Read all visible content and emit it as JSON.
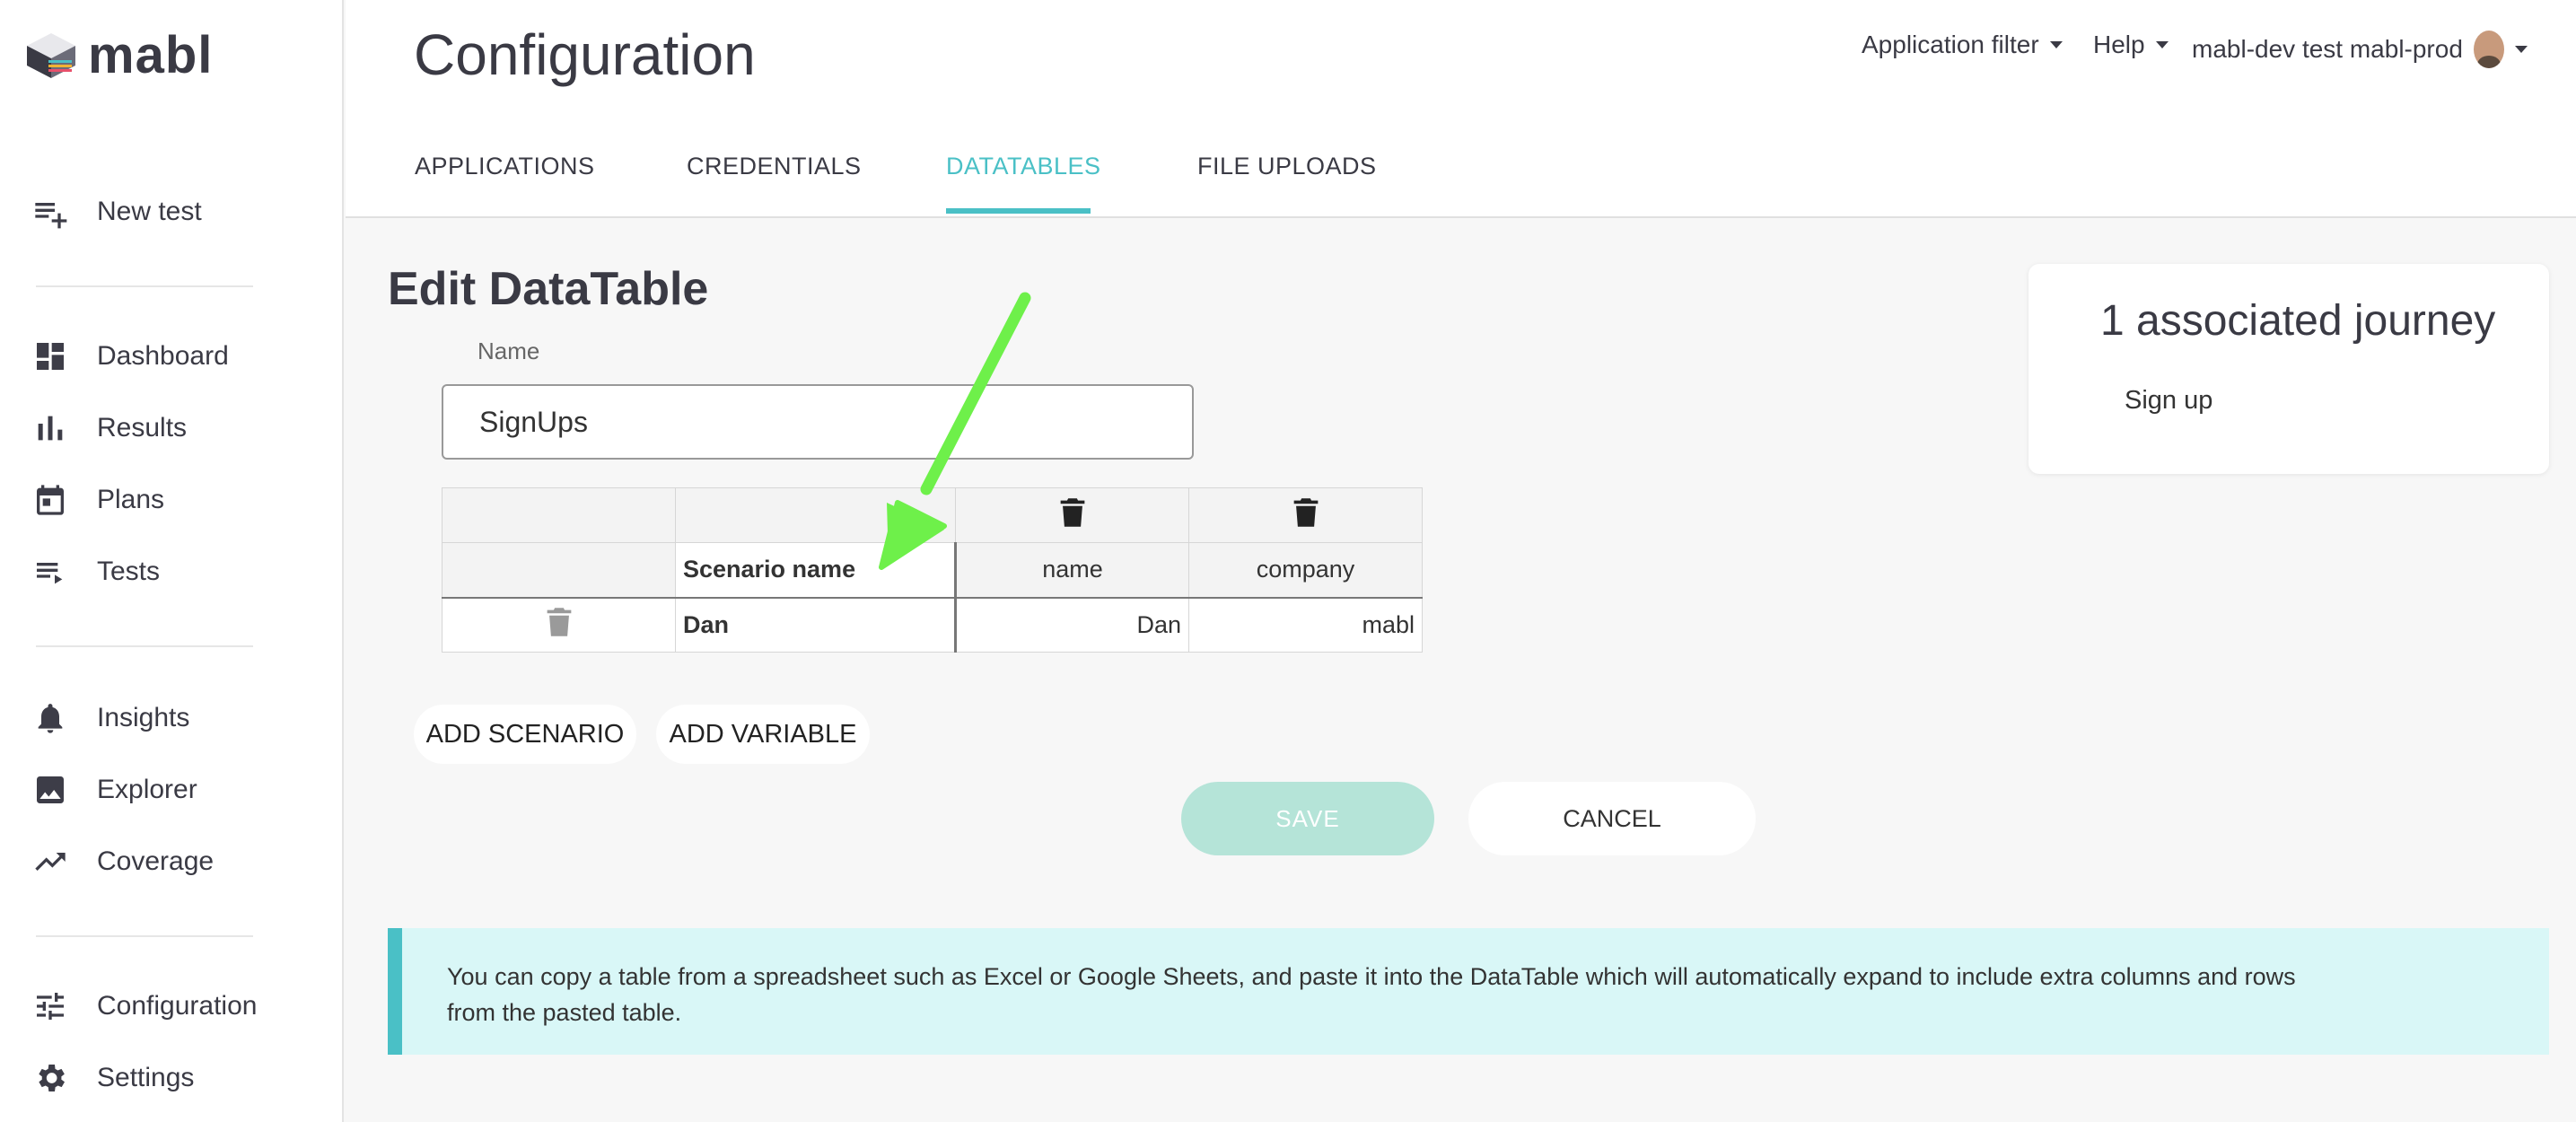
{
  "app": {
    "logo_text": "mabl"
  },
  "sidebar": {
    "items": [
      {
        "label": "New test",
        "icon": "playlist-add-icon"
      },
      {
        "label": "Dashboard",
        "icon": "dashboard-icon"
      },
      {
        "label": "Results",
        "icon": "bar-chart-icon"
      },
      {
        "label": "Plans",
        "icon": "calendar-icon"
      },
      {
        "label": "Tests",
        "icon": "playlist-play-icon"
      },
      {
        "label": "Insights",
        "icon": "bell-icon"
      },
      {
        "label": "Explorer",
        "icon": "image-icon"
      },
      {
        "label": "Coverage",
        "icon": "trending-up-icon"
      },
      {
        "label": "Configuration",
        "icon": "tune-icon"
      },
      {
        "label": "Settings",
        "icon": "gear-icon"
      }
    ]
  },
  "header": {
    "title": "Configuration",
    "application_filter": "Application filter",
    "help": "Help",
    "account": "mabl-dev test mabl-prod"
  },
  "tabs": [
    {
      "label": "APPLICATIONS"
    },
    {
      "label": "CREDENTIALS"
    },
    {
      "label": "DATATABLES",
      "active": true
    },
    {
      "label": "FILE UPLOADS"
    }
  ],
  "editor": {
    "title": "Edit DataTable",
    "name_label": "Name",
    "name_value": "SignUps",
    "table": {
      "columns": [
        "Scenario name",
        "name",
        "company"
      ],
      "rows": [
        {
          "scenario": "Dan",
          "name": "Dan",
          "company": "mabl"
        }
      ]
    },
    "add_scenario": "ADD SCENARIO",
    "add_variable": "ADD VARIABLE",
    "save": "SAVE",
    "cancel": "CANCEL",
    "info": "You can copy a table from a spreadsheet such as Excel or Google Sheets, and paste it into the DataTable which will automatically expand to include extra columns and rows from the pasted table."
  },
  "journeys": {
    "title": "1 associated journey",
    "items": [
      "Sign up"
    ]
  },
  "colors": {
    "accent": "#4ac0c6",
    "save_disabled": "#b5e4d8",
    "info_bg": "#d9f7f7",
    "annotation_arrow": "#6ef04a"
  }
}
